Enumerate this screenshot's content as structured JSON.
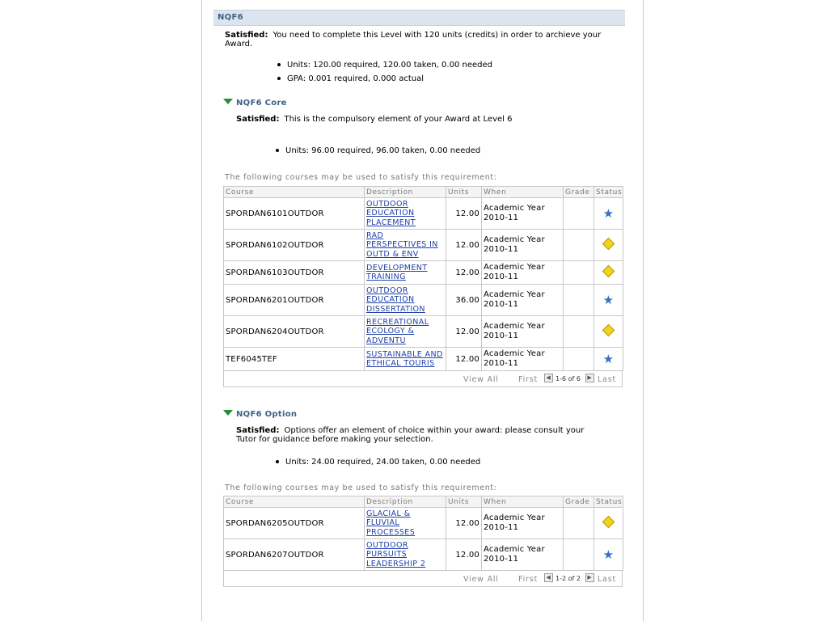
{
  "section": {
    "title": "NQF6",
    "satisfied_label": "Satisfied:",
    "satisfied_text": "You need to complete this Level with 120 units (credits) in order to archieve your Award.",
    "bullets": [
      "Units: 120.00 required, 120.00 taken, 0.00 needed",
      "GPA: 0.001 required, 0.000 actual"
    ]
  },
  "core": {
    "title": "NQF6 Core",
    "satisfied_label": "Satisfied:",
    "satisfied_text": "This is the compulsory element of your Award at Level 6",
    "bullet": "Units: 96.00 required, 96.00 taken, 0.00 needed",
    "intro": "The following courses may be used to satisfy this requirement:",
    "columns": [
      "Course",
      "Description",
      "Units",
      "When",
      "Grade",
      "Status"
    ],
    "rows": [
      {
        "course": "SPORDAN6101OUTDOR",
        "desc": [
          "OUTDOOR",
          "EDUCATION",
          "PLACEMENT"
        ],
        "units": "12.00",
        "when": [
          "Academic Year",
          "2010-11"
        ],
        "grade": "",
        "status_icon": "star-icon"
      },
      {
        "course": "SPORDAN6102OUTDOR",
        "desc": [
          "RAD",
          "PERSPECTIVES IN",
          "OUTD & ENV"
        ],
        "units": "12.00",
        "when": [
          "Academic Year",
          "2010-11"
        ],
        "grade": "",
        "status_icon": "diamond-icon"
      },
      {
        "course": "SPORDAN6103OUTDOR",
        "desc": [
          "DEVELOPMENT",
          "TRAINING"
        ],
        "units": "12.00",
        "when": [
          "Academic Year",
          "2010-11"
        ],
        "grade": "",
        "status_icon": "diamond-icon"
      },
      {
        "course": "SPORDAN6201OUTDOR",
        "desc": [
          "OUTDOOR",
          "EDUCATION",
          "DISSERTATION"
        ],
        "units": "36.00",
        "when": [
          "Academic Year",
          "2010-11"
        ],
        "grade": "",
        "status_icon": "star-icon"
      },
      {
        "course": "SPORDAN6204OUTDOR",
        "desc": [
          "RECREATIONAL",
          "ECOLOGY &",
          "ADVENTU"
        ],
        "units": "12.00",
        "when": [
          "Academic Year",
          "2010-11"
        ],
        "grade": "",
        "status_icon": "diamond-icon"
      },
      {
        "course": "TEF6045TEF",
        "desc": [
          "SUSTAINABLE AND",
          "ETHICAL TOURIS"
        ],
        "units": "12.00",
        "when": [
          "Academic Year",
          "2010-11"
        ],
        "grade": "",
        "status_icon": "star-icon"
      }
    ],
    "nav": {
      "view_all": "View All",
      "first": "First",
      "count": "1-6 of 6",
      "last": "Last"
    }
  },
  "option": {
    "title": "NQF6 Option",
    "satisfied_label": "Satisfied:",
    "satisfied_text_1": "Options offer an element of choice within your award: please consult your",
    "satisfied_text_2": "Tutor for guidance before making your selection.",
    "bullet": "Units: 24.00 required, 24.00 taken, 0.00 needed",
    "intro": "The following courses may be used to satisfy this requirement:",
    "columns": [
      "Course",
      "Description",
      "Units",
      "When",
      "Grade",
      "Status"
    ],
    "rows": [
      {
        "course": "SPORDAN6205OUTDOR",
        "desc": [
          "GLACIAL &",
          "FLUVIAL",
          "PROCESSES"
        ],
        "units": "12.00",
        "when": [
          "Academic Year",
          "2010-11"
        ],
        "grade": "",
        "status_icon": "diamond-icon"
      },
      {
        "course": "SPORDAN6207OUTDOR",
        "desc": [
          "OUTDOOR",
          "PURSUITS",
          "LEADERSHIP 2"
        ],
        "units": "12.00",
        "when": [
          "Academic Year",
          "2010-11"
        ],
        "grade": "",
        "status_icon": "star-icon"
      }
    ],
    "nav": {
      "view_all": "View All",
      "first": "First",
      "count": "1-2 of 2",
      "last": "Last"
    }
  },
  "colors": {
    "header_bg": "#dce4ee",
    "header_text": "#3f5f86",
    "link": "#1f3fa8",
    "star": "#3b6fc3",
    "diamond": "#f2d21f",
    "triangle": "#2a8c3a"
  }
}
